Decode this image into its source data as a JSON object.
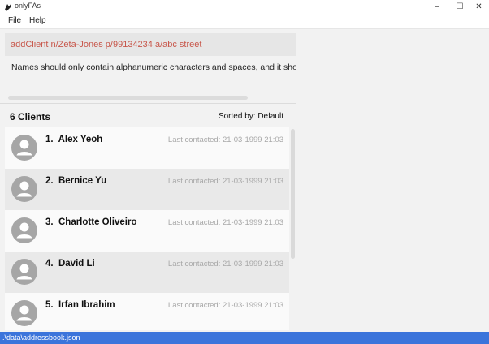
{
  "window": {
    "title": "onlyFAs",
    "app_icon": "app-logo-icon",
    "minimize_glyph": "–",
    "maximize_glyph": "☐",
    "close_glyph": "✕"
  },
  "menu": {
    "items": [
      "File",
      "Help"
    ]
  },
  "command": {
    "value": "addClient n/Zeta-Jones p/99134234 a/abc street",
    "text_color": "#c8574b"
  },
  "result": {
    "message": "Names should only contain alphanumeric characters and spaces, and it shou"
  },
  "list": {
    "count_label": "6 Clients",
    "sort_label": "Sorted by: Default",
    "clients": [
      {
        "index": "1.",
        "name": "Alex Yeoh",
        "last_contacted": "Last contacted: 21-03-1999 21:03"
      },
      {
        "index": "2.",
        "name": "Bernice Yu",
        "last_contacted": "Last contacted: 21-03-1999 21:03"
      },
      {
        "index": "3.",
        "name": "Charlotte Oliveiro",
        "last_contacted": "Last contacted: 21-03-1999 21:03"
      },
      {
        "index": "4.",
        "name": "David Li",
        "last_contacted": "Last contacted: 21-03-1999 21:03"
      },
      {
        "index": "5.",
        "name": "Irfan Ibrahim",
        "last_contacted": "Last contacted: 21-03-1999 21:03"
      }
    ]
  },
  "status": {
    "path": ".\\data\\addressbook.json",
    "bar_color": "#3b74db"
  }
}
